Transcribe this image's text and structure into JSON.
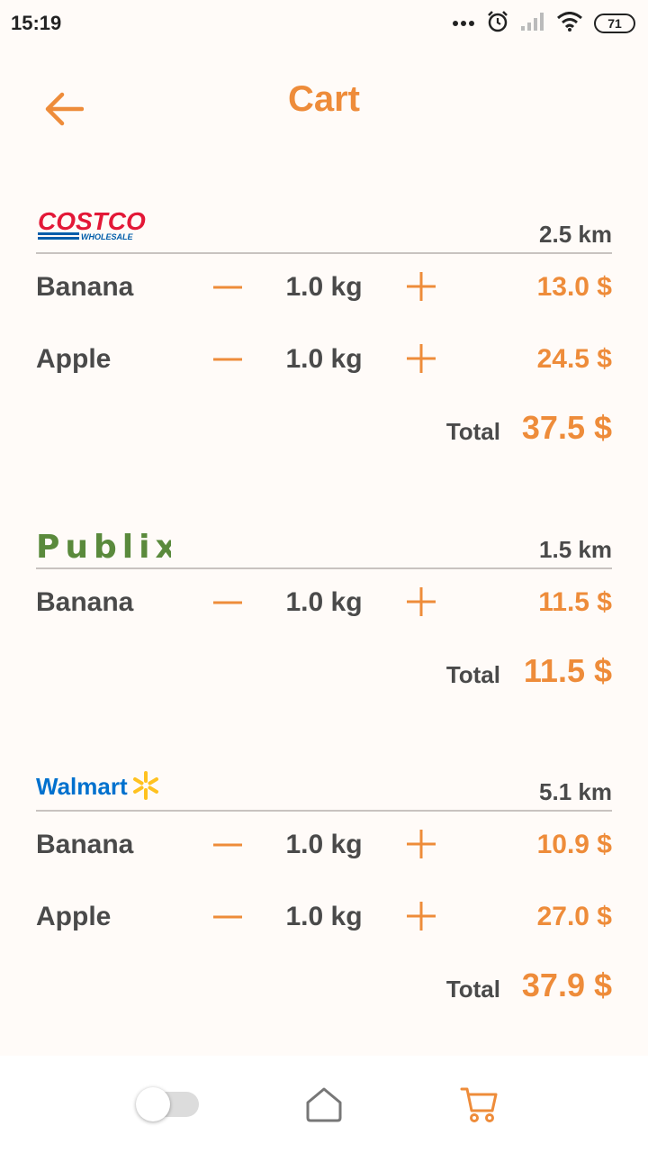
{
  "status_bar": {
    "time": "15:19",
    "battery": "71"
  },
  "header": {
    "title": "Cart",
    "back_icon": "arrow-left-icon"
  },
  "colors": {
    "accent": "#ee8c3a",
    "text": "#4a4a4a",
    "costco_red": "#e31837",
    "costco_blue": "#005daa",
    "publix_green": "#5a8a3c",
    "walmart_blue": "#0071ce",
    "walmart_yellow": "#ffc220"
  },
  "stores": [
    {
      "logo": "COSTCO",
      "logo_sub": "WHOLESALE",
      "distance": "2.5 km",
      "items": [
        {
          "name": "Banana",
          "qty": "1.0 kg",
          "price": "13.0 $"
        },
        {
          "name": "Apple",
          "qty": "1.0 kg",
          "price": "24.5 $"
        }
      ],
      "total_label": "Total",
      "total": "37.5 $"
    },
    {
      "logo": "Publix",
      "distance": "1.5 km",
      "items": [
        {
          "name": "Banana",
          "qty": "1.0 kg",
          "price": "11.5 $"
        }
      ],
      "total_label": "Total",
      "total": "11.5 $"
    },
    {
      "logo": "Walmart",
      "distance": "5.1 km",
      "items": [
        {
          "name": "Banana",
          "qty": "1.0 kg",
          "price": "10.9 $"
        },
        {
          "name": "Apple",
          "qty": "1.0 kg",
          "price": "27.0 $"
        }
      ],
      "total_label": "Total",
      "total": "37.9 $"
    }
  ],
  "bottom_nav": [
    {
      "icon": "toggle-switch-icon"
    },
    {
      "icon": "home-icon"
    },
    {
      "icon": "cart-icon",
      "active": true
    }
  ]
}
